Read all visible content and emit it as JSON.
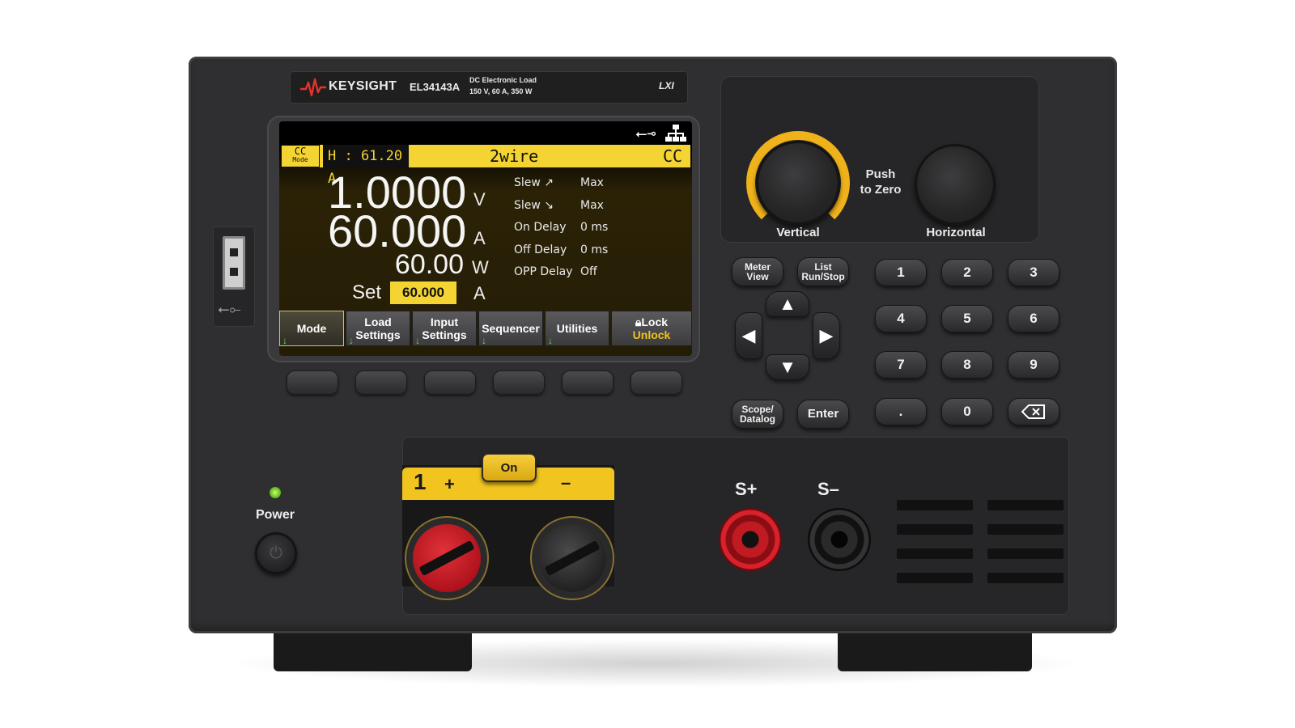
{
  "brand": {
    "name": "KEYSIGHT",
    "model": "EL34143A",
    "description_line1": "DC Electronic Load",
    "description_line2": "150 V, 60 A, 350 W",
    "lxi": "LXI"
  },
  "colors": {
    "accent_yellow": "#f3d432",
    "knob_ring": "#f0b21a",
    "softkey_arrow": "#6ee04a",
    "unlock_text": "#f3c21f",
    "power_led": "#59b21a",
    "red_post": "#c01a22"
  },
  "screen": {
    "status_icons": [
      "usb-icon",
      "network-icon"
    ],
    "mode_top": "CC",
    "mode_bottom": "Mode",
    "high_limit": "H : 61.20 A",
    "sense_mode": "2wire",
    "regulation": "CC",
    "voltage_value": "1.0000",
    "voltage_unit": "V",
    "current_value": "60.000",
    "current_unit": "A",
    "power_value": "60.00",
    "power_unit": "W",
    "set_label": "Set",
    "set_value": "60.000",
    "set_unit": "A",
    "params": [
      {
        "label": "Slew ↗",
        "value": "Max"
      },
      {
        "label": "Slew ↘",
        "value": "Max"
      },
      {
        "label": "On  Delay",
        "value": "0 ms"
      },
      {
        "label": "Off  Delay",
        "value": "0 ms"
      },
      {
        "label": "OPP Delay",
        "value": "Off"
      }
    ],
    "softkeys": [
      {
        "line1": "Mode",
        "line2": ""
      },
      {
        "line1": "Load",
        "line2": "Settings"
      },
      {
        "line1": "Input",
        "line2": "Settings"
      },
      {
        "line1": "Sequencer",
        "line2": ""
      },
      {
        "line1": "Utilities",
        "line2": ""
      },
      {
        "line1": "Lock",
        "line2": "Unlock"
      }
    ],
    "arrow_glyph": "↓"
  },
  "knobs": {
    "push_to_zero": "Push\nto Zero",
    "vertical_label": "Vertical",
    "horizontal_label": "Horizontal"
  },
  "function_keys": {
    "meter_view": "Meter\nView",
    "list_run_stop": "List\nRun/Stop",
    "scope_datalog": "Scope/\nDatalog",
    "enter": "Enter"
  },
  "keypad": [
    "1",
    "2",
    "3",
    "4",
    "5",
    "6",
    "7",
    "8",
    "9",
    ".",
    "0"
  ],
  "output": {
    "on_label": "On",
    "channel": "1",
    "plus": "+",
    "minus": "–",
    "sense_plus": "S+",
    "sense_minus": "S–"
  },
  "power": {
    "label": "Power"
  }
}
